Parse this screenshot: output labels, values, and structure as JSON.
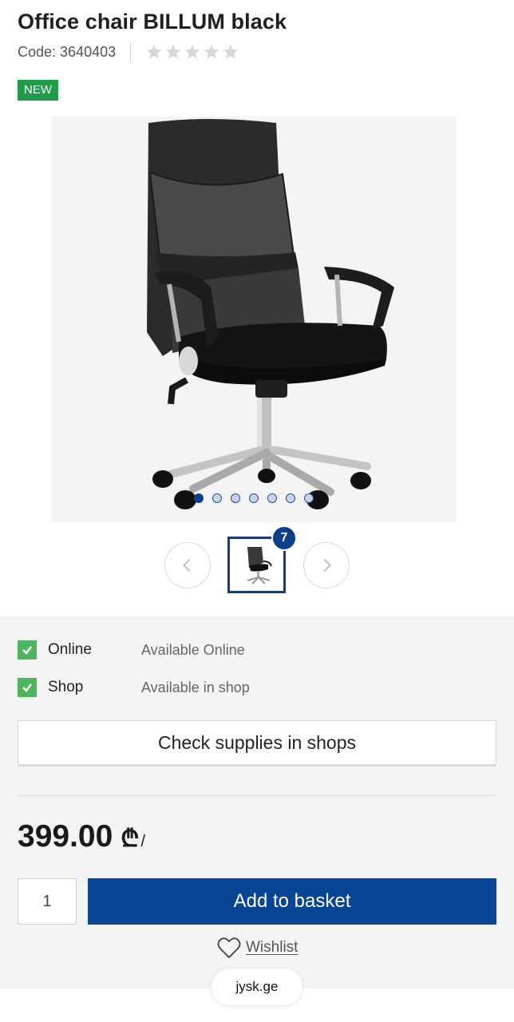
{
  "product": {
    "title": "Office chair BILLUM black",
    "code": "Code: 3640403",
    "rating_stars": 5,
    "rating_value": 0,
    "badge": "NEW"
  },
  "gallery": {
    "dots_count": 7,
    "active_dot": 1,
    "thumbnail_count": "7"
  },
  "availability": {
    "items": [
      {
        "label": "Online",
        "value": "Available Online",
        "checked": true
      },
      {
        "label": "Shop",
        "value": "Available in shop",
        "checked": true
      }
    ],
    "check_button": "Check supplies in shops"
  },
  "price": {
    "amount": "399.00",
    "currency": "₾",
    "separator": "/"
  },
  "purchase": {
    "quantity": "1",
    "add_button": "Add to basket",
    "wishlist": "Wishlist"
  },
  "browser": {
    "url": "jysk.ge"
  },
  "colors": {
    "primary": "#0a4495",
    "badge_new": "#1f9b4a",
    "check": "#4db65c",
    "star_empty": "#d6d6d6"
  },
  "icons": [
    "star-icon",
    "chevron-left-icon",
    "chevron-right-icon",
    "checkmark-icon",
    "heart-icon"
  ]
}
